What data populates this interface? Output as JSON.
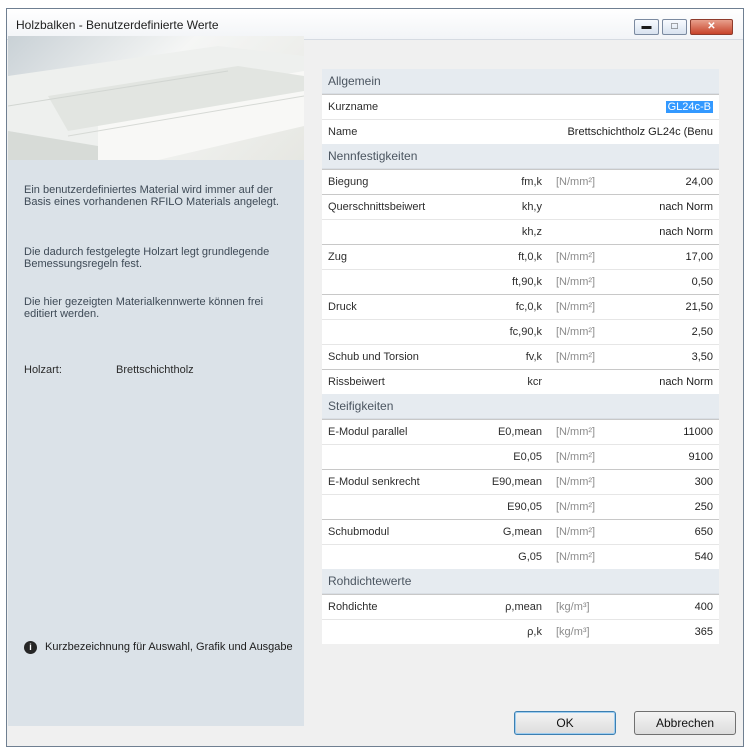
{
  "window": {
    "title": "Holzbalken - Benutzerdefinierte Werte",
    "minimize_glyph": "▬",
    "maximize_glyph": "□",
    "close_glyph": "✕"
  },
  "info_panel": {
    "paragraphs": [
      "Ein benutzerdefiniertes Material wird immer auf der Basis eines vorhandenen RFILO Materials angelegt.",
      "Die dadurch festgelegte Holzart legt grundlegende Bemessungsregeln fest.",
      "Die hier gezeigten Materialkennwerte können frei editiert werden."
    ],
    "wood_type_label": "Holzart:",
    "wood_type_value": "Brettschichtholz",
    "hint_icon_glyph": "i",
    "hint": "Kurzbezeichnung für Auswahl, Grafik und Ausgabe"
  },
  "sections": {
    "allgemein": "Allgemein",
    "nennfestigkeiten": "Nennfestigkeiten",
    "steifigkeiten": "Steifigkeiten",
    "rohdichtewerte": "Rohdichtewerte"
  },
  "allgemein": {
    "kurzname_label": "Kurzname",
    "kurzname_value": "GL24c-B",
    "name_label": "Name",
    "name_value": "Brettschichtholz GL24c (Benu"
  },
  "nennfestigkeiten": [
    {
      "name": "Biegung",
      "symbol": "fm,k",
      "unit": "[N/mm²]",
      "value": "24,00"
    },
    {
      "name": "Querschnittsbeiwert",
      "symbol": "kh,y",
      "unit": "",
      "value": "nach Norm"
    },
    {
      "name": "",
      "symbol": "kh,z",
      "unit": "",
      "value": "nach Norm"
    },
    {
      "name": "Zug",
      "symbol": "ft,0,k",
      "unit": "[N/mm²]",
      "value": "17,00"
    },
    {
      "name": "",
      "symbol": "ft,90,k",
      "unit": "[N/mm²]",
      "value": "0,50"
    },
    {
      "name": "Druck",
      "symbol": "fc,0,k",
      "unit": "[N/mm²]",
      "value": "21,50"
    },
    {
      "name": "",
      "symbol": "fc,90,k",
      "unit": "[N/mm²]",
      "value": "2,50"
    },
    {
      "name": "Schub und Torsion",
      "symbol": "fv,k",
      "unit": "[N/mm²]",
      "value": "3,50"
    },
    {
      "name": "Rissbeiwert",
      "symbol": "kcr",
      "unit": "",
      "value": "nach Norm"
    }
  ],
  "steifigkeiten": [
    {
      "name": "E-Modul parallel",
      "symbol": "E0,mean",
      "unit": "[N/mm²]",
      "value": "11000"
    },
    {
      "name": "",
      "symbol": "E0,05",
      "unit": "[N/mm²]",
      "value": "9100"
    },
    {
      "name": "E-Modul senkrecht",
      "symbol": "E90,mean",
      "unit": "[N/mm²]",
      "value": "300"
    },
    {
      "name": "",
      "symbol": "E90,05",
      "unit": "[N/mm²]",
      "value": "250"
    },
    {
      "name": "Schubmodul",
      "symbol": "G,mean",
      "unit": "[N/mm²]",
      "value": "650"
    },
    {
      "name": "",
      "symbol": "G,05",
      "unit": "[N/mm²]",
      "value": "540"
    }
  ],
  "rohdichtewerte": [
    {
      "name": "Rohdichte",
      "symbol": "ρ,mean",
      "unit": "[kg/m³]",
      "value": "400"
    },
    {
      "name": "",
      "symbol": "ρ,k",
      "unit": "[kg/m³]",
      "value": "365"
    }
  ],
  "buttons": {
    "ok": "OK",
    "cancel": "Abbrechen"
  }
}
